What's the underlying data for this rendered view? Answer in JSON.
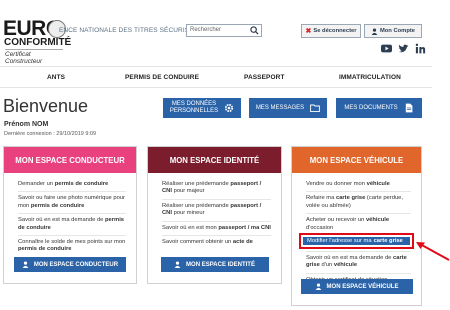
{
  "header": {
    "logo_euro": "EURO",
    "logo_conformite": "CONFORMITÉ",
    "logo_cert": "Certificat Constructeur",
    "agency": "ENCE NATIONALE DES TITRES SÉCURISÉS",
    "search_placeholder": "Rechercher",
    "logout_label": "Se déconnecter",
    "account_label": "Mon Compte"
  },
  "nav": {
    "items": [
      "ANTS",
      "PERMIS DE CONDUIRE",
      "PASSEPORT",
      "IMMATRICULATION"
    ]
  },
  "welcome": {
    "title": "Bienvenue",
    "name": "Prénom NOM",
    "last_login": "Dernière connexion : 29/10/2019 9:09"
  },
  "quick": {
    "donnees_1": "MES DONNÉES",
    "donnees_2": "PERSONNELLES",
    "messages": "MES MESSAGES",
    "documents": "MES DOCUMENTS"
  },
  "cards": {
    "conducteur": {
      "title": "MON ESPACE CONDUCTEUR",
      "items": [
        [
          "Demander un ",
          "permis de conduire",
          ""
        ],
        [
          "Savoir ou faire une photo numérique pour mon ",
          "permis de conduire",
          ""
        ],
        [
          "Savoir où en est ma demande de ",
          "permis de conduire",
          ""
        ],
        [
          "Connaître le solde de mes points sur mon ",
          "permis de conduire",
          ""
        ]
      ],
      "cta": "MON ESPACE CONDUCTEUR"
    },
    "identite": {
      "title": "MON ESPACE IDENTITÉ",
      "items": [
        [
          "Réaliser une prédemande ",
          "passeport / CNI",
          " pour majeur"
        ],
        [
          "Réaliser une prédemande ",
          "passeport / CNI",
          " pour mineur"
        ],
        [
          "Savoir où en est mon ",
          "passeport / ma CNI",
          ""
        ],
        [
          "Savoir comment obtenir un ",
          "acte de",
          ""
        ]
      ],
      "cta": "MON ESPACE IDENTITÉ"
    },
    "vehicule": {
      "title": "MON ESPACE VÉHICULE",
      "items": [
        [
          "Vendre ou donner mon ",
          "véhicule",
          ""
        ],
        [
          "Refaire ma ",
          "carte grise",
          " (carte perdue, volée ou abîmée)"
        ],
        [
          "Acheter ou recevoir un ",
          "véhicule",
          " d'occasion"
        ],
        [
          "",
          "",
          ""
        ],
        [
          "Savoir où en est ma demande de ",
          "carte grise",
          " d'un ",
          "véhicule"
        ],
        [
          "Obtenir un certificat de situation",
          "",
          ""
        ]
      ],
      "highlight_prefix": "Modifier l'adresse sur ma ",
      "highlight_bold": "carte grise",
      "cta": "MON ESPACE VÉHICULE"
    }
  },
  "colors": {
    "conducteur": "#e8417d",
    "identite": "#7c1d2e",
    "vehicule": "#e1662b",
    "button": "#2b63a8",
    "highlight": "#e00b17"
  }
}
